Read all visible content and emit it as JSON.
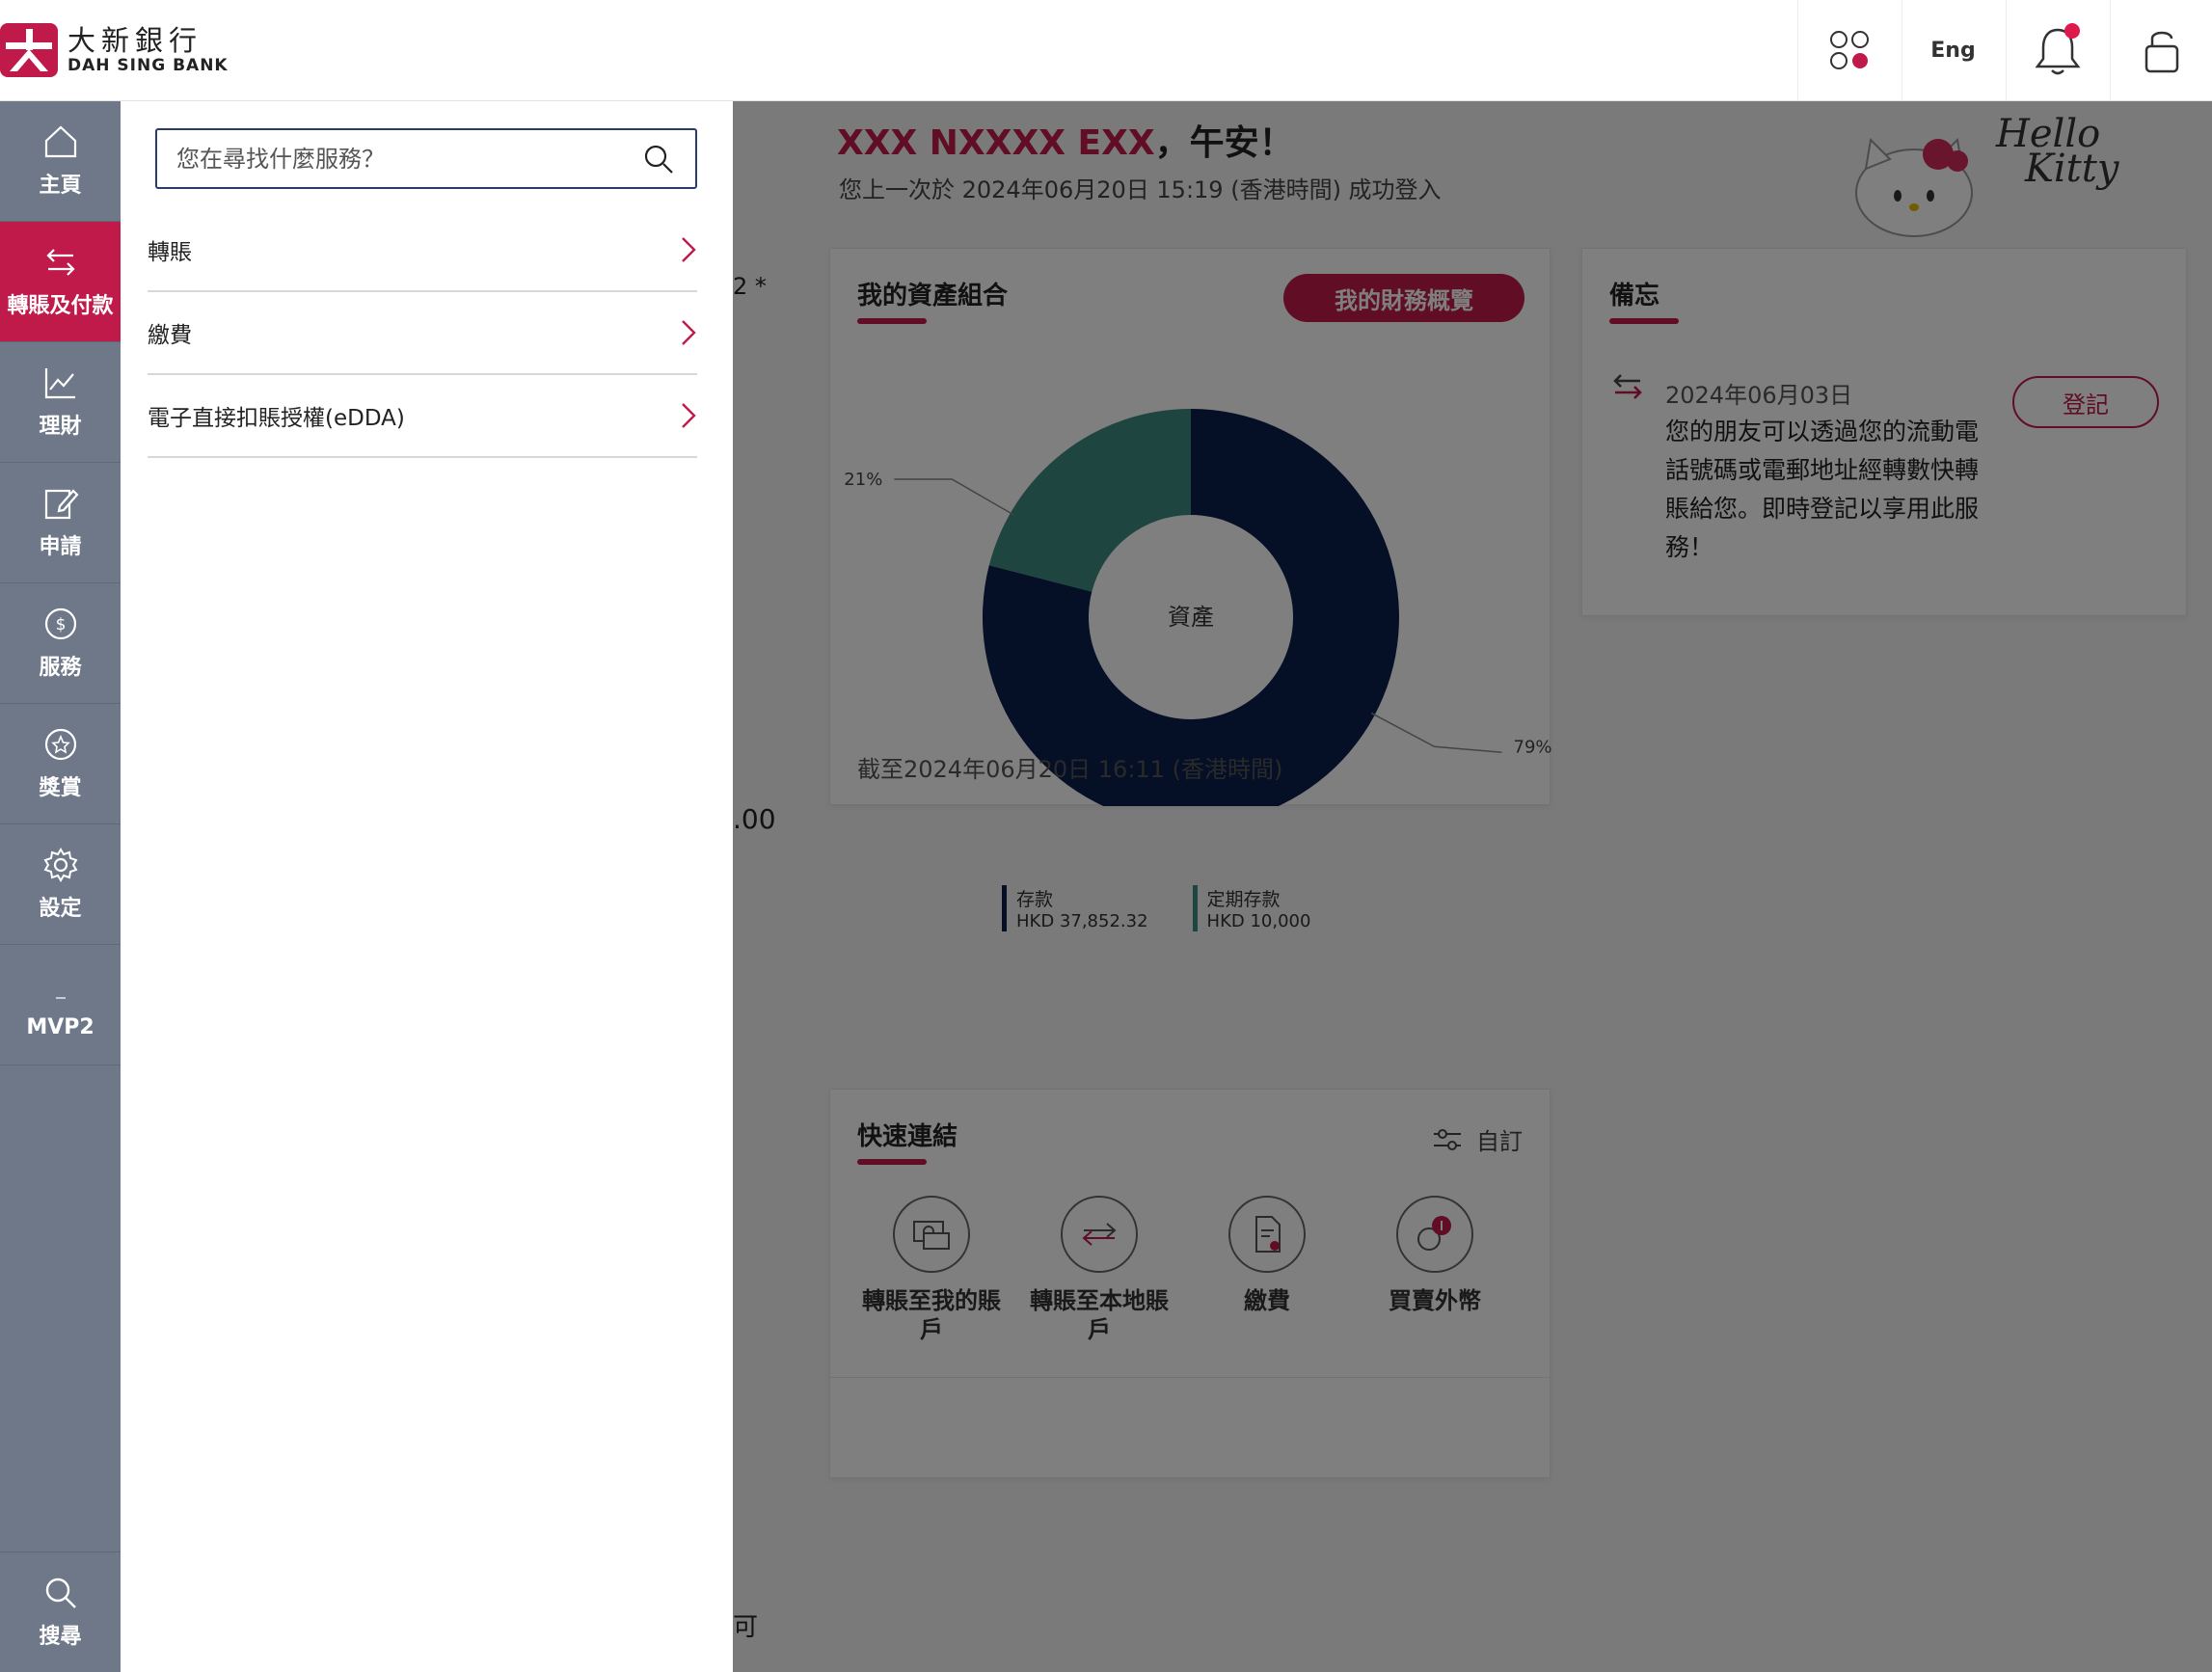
{
  "brand": {
    "name_cn": "大新銀行",
    "name_en": "DAH SING BANK",
    "color": "#c01a4b"
  },
  "header": {
    "lang_label": "Eng"
  },
  "sidebar": {
    "items": [
      {
        "label": "主頁",
        "icon": "home-icon"
      },
      {
        "label": "轉賬及付款",
        "icon": "transfer-icon",
        "active": true
      },
      {
        "label": "理財",
        "icon": "chart-icon"
      },
      {
        "label": "申請",
        "icon": "edit-icon"
      },
      {
        "label": "服務",
        "icon": "dollar-icon"
      },
      {
        "label": "獎賞",
        "icon": "star-icon"
      },
      {
        "label": "設定",
        "icon": "gear-icon"
      },
      {
        "label": "MVP2",
        "icon": "dash-icon"
      }
    ],
    "search_label": "搜尋"
  },
  "panel": {
    "search_placeholder": "您在尋找什麼服務？",
    "menu": [
      {
        "label": "轉賬"
      },
      {
        "label": "繳費"
      },
      {
        "label": "電子直接扣賬授權(eDDA)"
      }
    ]
  },
  "main": {
    "greeting_name": "XXX NXXXX EXX",
    "greeting_text": "，午安！",
    "last_login": "您上一次於 2024年06月20日 15:19 (香港時間) 成功登入",
    "bleed_texts": {
      "top": "2 *",
      "amount": ".00",
      "lower": "可"
    },
    "portfolio": {
      "title": "我的資產組合",
      "overview_button": "我的財務概覽",
      "center_label": "資產",
      "as_of": "截至2024年06月20日 16:11 (香港時間)",
      "legend": [
        {
          "name": "存款",
          "amount": "HKD 37,852.32",
          "color": "#0a1e4d"
        },
        {
          "name": "定期存款",
          "amount": "HKD 10,000",
          "color": "#3f8a80"
        }
      ]
    },
    "memo": {
      "title": "備忘",
      "date": "2024年06月03日",
      "text": "您的朋友可以透過您的流動電話號碼或電郵地址經轉數快轉賬給您。即時登記以享用此服務！",
      "register_button": "登記"
    },
    "quick_links": {
      "title": "快速連結",
      "customize_label": "自訂",
      "items": [
        {
          "line1": "轉賬至我的賬",
          "line2": "戶",
          "icon": "money-icon"
        },
        {
          "line1": "轉賬至本地賬",
          "line2": "戶",
          "icon": "exchange-arrows-icon"
        },
        {
          "line1": "繳費",
          "line2": "",
          "icon": "bill-icon"
        },
        {
          "line1": "買賣外幣",
          "line2": "",
          "icon": "currency-icon"
        }
      ]
    },
    "hello_kitty": {
      "line1": "Hello",
      "line2": "Kitty"
    }
  },
  "chart_data": {
    "type": "pie",
    "title": "",
    "categories": [
      "存款",
      "定期存款"
    ],
    "values": [
      79,
      21
    ],
    "labels": [
      "79%",
      "21%"
    ],
    "colors": [
      "#0a1e4d",
      "#3f8a80"
    ]
  }
}
